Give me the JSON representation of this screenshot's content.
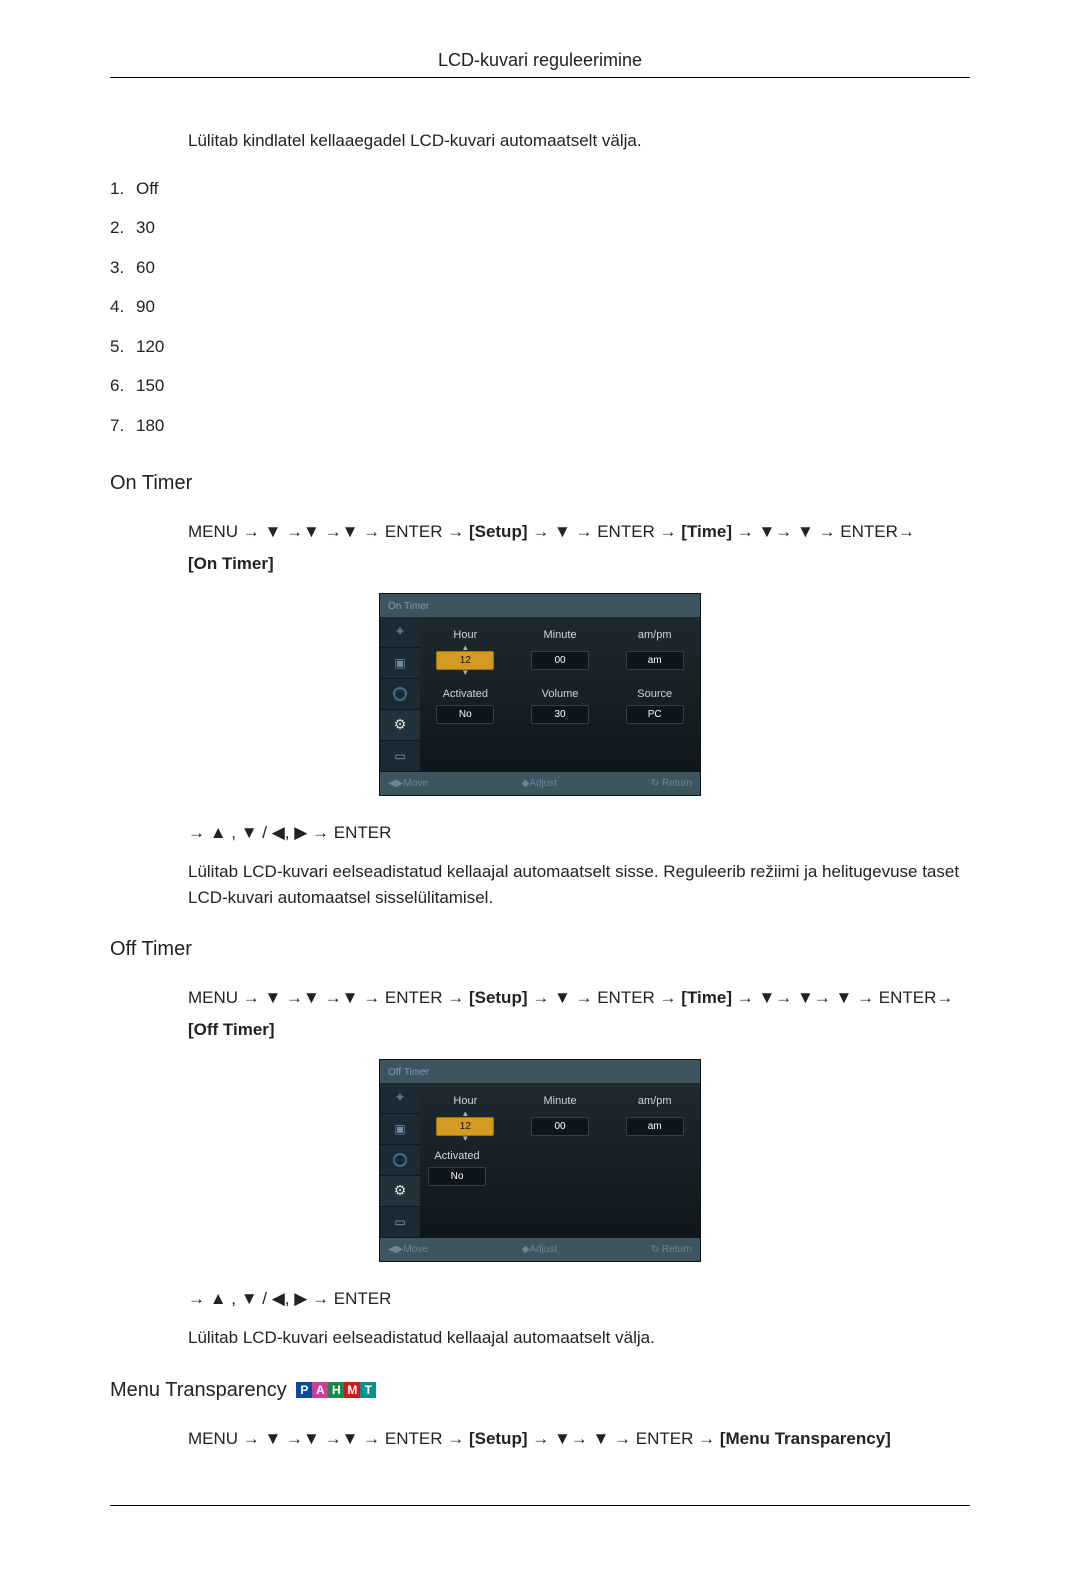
{
  "header": {
    "title": "LCD-kuvari reguleerimine"
  },
  "intro": "Lülitab kindlatel kellaaegadel LCD-kuvari automaatselt välja.",
  "options": [
    {
      "n": "1.",
      "v": "Off"
    },
    {
      "n": "2.",
      "v": "30"
    },
    {
      "n": "3.",
      "v": "60"
    },
    {
      "n": "4.",
      "v": "90"
    },
    {
      "n": "5.",
      "v": "120"
    },
    {
      "n": "6.",
      "v": "150"
    },
    {
      "n": "7.",
      "v": "180"
    }
  ],
  "sections": {
    "ontimer": {
      "heading": "On Timer",
      "path": {
        "pre": "MENU → ▼ →▼ →▼ → ENTER → ",
        "setup": "[Setup]",
        "mid1": " → ▼ → ENTER → ",
        "time": "[Time]",
        "mid2": "→ ▼→ ▼ → ENTER→ ",
        "last": "[On Timer]"
      },
      "osd": {
        "title": "On Timer",
        "labels": {
          "hour": "Hour",
          "minute": "Minute",
          "ampm": "am/pm",
          "activated": "Activated",
          "volume": "Volume",
          "source": "Source"
        },
        "values": {
          "hour": "12",
          "minute": "00",
          "ampm": "am",
          "activated": "No",
          "volume": "30",
          "source": "PC"
        },
        "footer": {
          "move": "◀▶Move",
          "adjust": "◆Adjust",
          "return": "↻ Return"
        }
      },
      "after": "→ ▲ , ▼ / ◀, ▶ → ENTER",
      "desc": "Lülitab LCD-kuvari eelseadistatud kellaajal automaatselt sisse. Reguleerib režiimi ja helitugevuse taset LCD-kuvari automaatsel sisselülitamisel."
    },
    "offtimer": {
      "heading": "Off Timer",
      "path": {
        "pre": "MENU → ▼ →▼ →▼ → ENTER → ",
        "setup": "[Setup]",
        "mid1": " → ▼ → ENTER → ",
        "time": "[Time]",
        "mid2": "→ ▼→ ▼→ ▼ → ENTER→ ",
        "last": "[Off Timer]"
      },
      "osd": {
        "title": "Off Timer",
        "labels": {
          "hour": "Hour",
          "minute": "Minute",
          "ampm": "am/pm",
          "activated": "Activated"
        },
        "values": {
          "hour": "12",
          "minute": "00",
          "ampm": "am",
          "activated": "No"
        },
        "footer": {
          "move": "◀▶Move",
          "adjust": "◆Adjust",
          "return": "↻ Return"
        }
      },
      "after": "→ ▲ , ▼ / ◀, ▶ → ENTER",
      "desc": "Lülitab LCD-kuvari eelseadistatud kellaajal automaatselt välja."
    },
    "menutrans": {
      "heading": "Menu Transparency",
      "badges": [
        "P",
        "A",
        "H",
        "M",
        "T"
      ],
      "path": {
        "pre": "MENU → ▼ →▼ →▼ → ENTER → ",
        "setup": "[Setup]",
        "mid1": " → ▼→ ▼ → ENTER → ",
        "last": "[Menu Transparency]"
      }
    }
  }
}
